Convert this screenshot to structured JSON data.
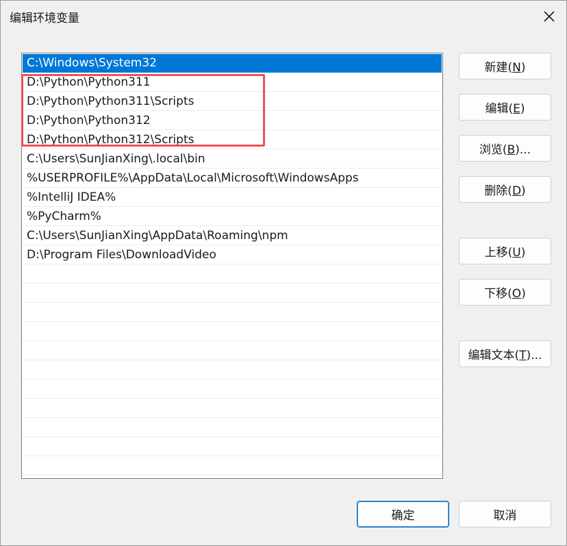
{
  "window": {
    "title": "编辑环境变量",
    "close_icon": "close-icon"
  },
  "path_list": {
    "items": [
      "C:\\Windows\\System32",
      "D:\\Python\\Python311",
      "D:\\Python\\Python311\\Scripts",
      "D:\\Python\\Python312",
      "D:\\Python\\Python312\\Scripts",
      "C:\\Users\\SunJianXing\\.local\\bin",
      "%USERPROFILE%\\AppData\\Local\\Microsoft\\WindowsApps",
      "%IntelliJ IDEA%",
      "%PyCharm%",
      "C:\\Users\\SunJianXing\\AppData\\Roaming\\npm",
      "D:\\Program Files\\DownloadVideo"
    ],
    "selected_index": 0,
    "selection_color": "#0078d7",
    "annotation_color": "#ef5054"
  },
  "buttons": {
    "new": {
      "label": "新建(",
      "key": "N",
      "suffix": ")"
    },
    "edit": {
      "label": "编辑(",
      "key": "E",
      "suffix": ")"
    },
    "browse": {
      "label": "浏览(",
      "key": "B",
      "suffix": ")..."
    },
    "delete": {
      "label": "删除(",
      "key": "D",
      "suffix": ")"
    },
    "move_up": {
      "label": "上移(",
      "key": "U",
      "suffix": ")"
    },
    "move_down": {
      "label": "下移(",
      "key": "O",
      "suffix": ")"
    },
    "edit_text": {
      "label": "编辑文本(",
      "key": "T",
      "suffix": ")..."
    },
    "ok": {
      "label": "确定"
    },
    "cancel": {
      "label": "取消"
    }
  }
}
